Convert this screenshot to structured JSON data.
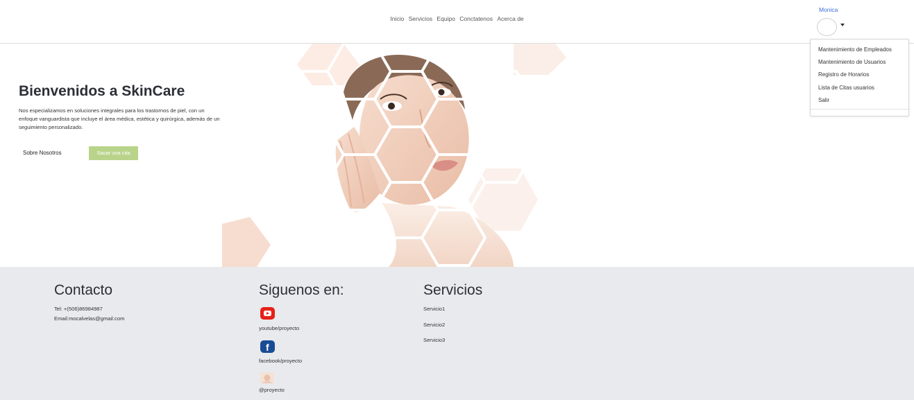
{
  "nav": {
    "items": [
      "Inicio",
      "Servicios",
      "Equipo",
      "Conctatenos",
      "Acerca de"
    ]
  },
  "user": {
    "name": "Monica",
    "menu": [
      "Mantenimiento de Empleados",
      "Mantenimiento de Usuarios",
      "Registro de Horarios",
      "Lista de Citas usuarios",
      "Salir"
    ]
  },
  "hero": {
    "title": "Bienvenidos a SkinCare",
    "description": "Nos especializamos en soluciones integrales para los trastornos de piel, con un enfoque vanguardista que incluye el área médica, estética y quirúrgica, además de un seguimiento personalizado.",
    "about_label": "Sobre Nosotros",
    "cta_label": "Sacar una cita"
  },
  "footer": {
    "contact": {
      "title": "Contacto",
      "phone": "Tel: +(506)86984987",
      "email": "Email:mocalvelas@gmail.com"
    },
    "social": {
      "title": "Siguenos en:",
      "youtube": "youtube/proyecto",
      "facebook": "facebook/proyecto",
      "instagram": "@proyecto"
    },
    "services": {
      "title": "Servicios",
      "items": [
        "Servicio1",
        "Servicio2",
        "Servicio3"
      ]
    }
  },
  "colors": {
    "accent_button": "#b9d48a",
    "footer_bg": "#e8eaee",
    "user_link": "#3a6fd8",
    "youtube": "#e62117",
    "facebook": "#1a4c95"
  },
  "icons": [
    "youtube-icon",
    "facebook-icon",
    "instagram-icon",
    "avatar",
    "caret-down-icon"
  ]
}
